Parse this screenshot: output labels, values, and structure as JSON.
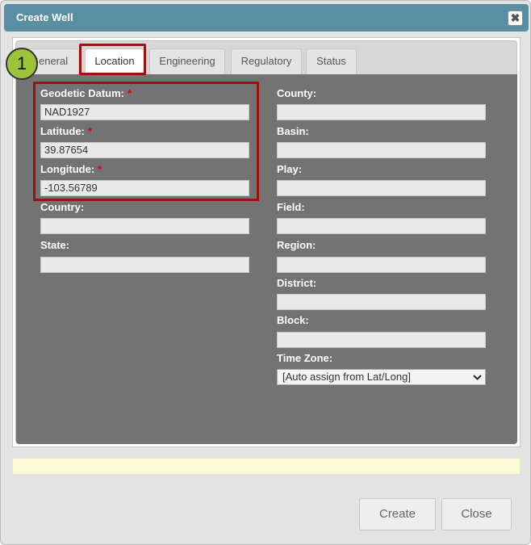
{
  "window": {
    "title": "Create Well",
    "close_glyph": "✖"
  },
  "tabs": [
    {
      "label": "General"
    },
    {
      "label": "Location"
    },
    {
      "label": "Engineering"
    },
    {
      "label": "Regulatory"
    },
    {
      "label": "Status"
    }
  ],
  "active_tab": "Location",
  "callout": {
    "number": "1"
  },
  "left_fields": {
    "geodetic_datum": {
      "label": "Geodetic Datum:",
      "required": "*",
      "value": "NAD1927"
    },
    "latitude": {
      "label": "Latitude:",
      "required": "*",
      "value": "39.87654"
    },
    "longitude": {
      "label": "Longitude:",
      "required": "*",
      "value": "-103.56789"
    },
    "country": {
      "label": "Country:",
      "value": ""
    },
    "state": {
      "label": "State:",
      "value": ""
    }
  },
  "right_fields": {
    "county": {
      "label": "County:",
      "value": ""
    },
    "basin": {
      "label": "Basin:",
      "value": ""
    },
    "play": {
      "label": "Play:",
      "value": ""
    },
    "field": {
      "label": "Field:",
      "value": ""
    },
    "region": {
      "label": "Region:",
      "value": ""
    },
    "district": {
      "label": "District:",
      "value": ""
    },
    "block": {
      "label": "Block:",
      "value": ""
    },
    "time_zone": {
      "label": "Time Zone:",
      "value": "[Auto assign from Lat/Long]"
    }
  },
  "buttons": {
    "create": "Create",
    "close": "Close"
  },
  "colors": {
    "titlebar": "#5a8fa3",
    "content_bg": "#737373",
    "highlight": "#a01010",
    "callout": "#9bc43a",
    "required": "#e00000",
    "message_bar": "#fbf9d8"
  }
}
